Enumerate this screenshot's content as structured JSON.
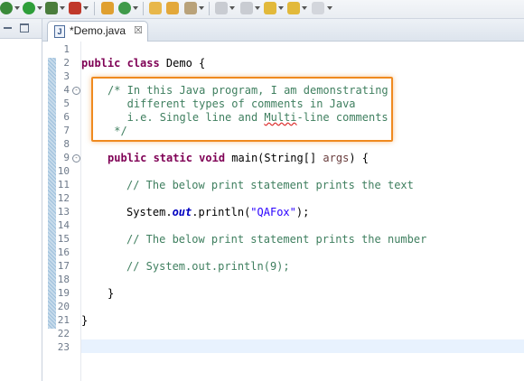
{
  "editor": {
    "tab": {
      "label": "*Demo.java",
      "icon": "java-file-icon",
      "close_glyph": "☒"
    },
    "line_numbers": [
      "1",
      "2",
      "3",
      "4",
      "5",
      "6",
      "7",
      "8",
      "9",
      "10",
      "11",
      "12",
      "13",
      "14",
      "15",
      "16",
      "17",
      "18",
      "19",
      "20",
      "21",
      "22",
      "23"
    ],
    "lines": {
      "l2_kw": "public class",
      "l2_rest": " Demo {",
      "l4": "/* In this Java program, I am demonstrating",
      "l5": "   different types of comments in Java",
      "l6a": "   i.e. Single line and ",
      "l6b": "Multi",
      "l6c": "-line comments",
      "l7": " */",
      "l9_kw": "public static void",
      "l9_a": " main(String[] ",
      "l9_args": "args",
      "l9_b": ") {",
      "l11": "// The below print statement prints the text",
      "l13_a": "System.",
      "l13_out": "out",
      "l13_b": ".println(",
      "l13_str": "\"QAFox\"",
      "l13_c": ");",
      "l15": "// The below print statement prints the number",
      "l17": "// System.out.println(9);",
      "l19": "}",
      "l21": "}"
    }
  },
  "colors": {
    "keyword": "#7f0055",
    "comment": "#3f7f5f",
    "string": "#2a00ff",
    "highlight_box": "#ef8a1f"
  }
}
